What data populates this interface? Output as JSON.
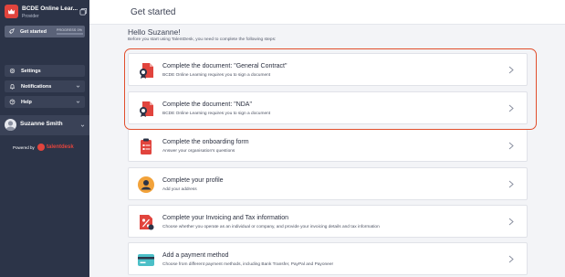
{
  "brand": {
    "name": "BCDE Online Lear...",
    "role": "Provider"
  },
  "sidebar": {
    "get_started": {
      "label": "Get started",
      "progress_label": "PROGRESS 0%",
      "progress": 0
    },
    "items": [
      {
        "label": "Settings"
      },
      {
        "label": "Notifications"
      },
      {
        "label": "Help"
      }
    ],
    "user": {
      "name": "Suzanne Smith"
    },
    "powered_by": "Powered by",
    "powered_brand": "talentdesk"
  },
  "header": {
    "title": "Get started"
  },
  "main": {
    "greeting": "Hello Suzanne!",
    "subtitle": "Before you start using TalentDesk, you need to complete the following steps:",
    "steps": [
      {
        "title": "Complete the document: \"General Contract\"",
        "description": "BCDE Online Learning requires you to sign a document",
        "icon": "document-seal-icon"
      },
      {
        "title": "Complete the document: \"NDA\"",
        "description": "BCDE Online Learning requires you to sign a document",
        "icon": "document-seal-icon"
      },
      {
        "title": "Complete the onboarding form",
        "description": "Answer your organisation's questions",
        "icon": "clipboard-icon"
      },
      {
        "title": "Complete your profile",
        "description": "Add your address",
        "icon": "profile-icon"
      },
      {
        "title": "Complete your Invoicing and Tax information",
        "description": "Choose whether you operate as an individual or company, and provide your invoicing details and tax information",
        "icon": "tax-icon"
      },
      {
        "title": "Add a payment method",
        "description": "Choose from different payment methods, including Bank Transfer, PayPal and Payoneer",
        "icon": "credit-card-icon"
      }
    ]
  },
  "colors": {
    "sidebar": "#2c3448",
    "accent": "#e1443d",
    "highlight": "#e14e2c"
  }
}
